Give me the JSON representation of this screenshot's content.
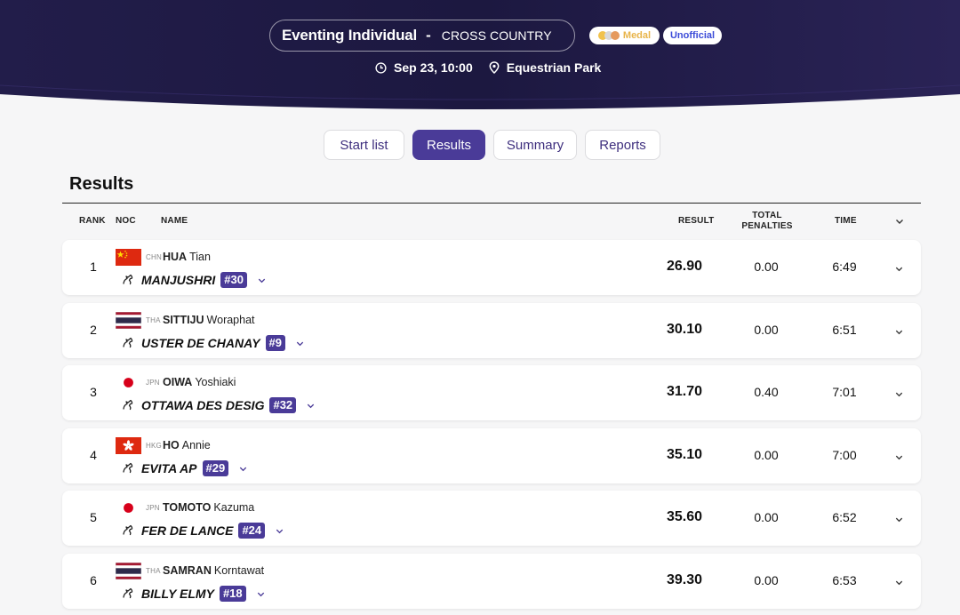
{
  "header": {
    "event_name": "Eventing Individual",
    "separator": "-",
    "phase": "CROSS COUNTRY",
    "badge_medal": "Medal",
    "badge_unofficial": "Unofficial",
    "datetime": "Sep 23, 10:00",
    "venue": "Equestrian Park",
    "colors": {
      "background": "#1e1a42",
      "medal_text": "#e8b44a",
      "unofficial_text": "#3b4bd8"
    }
  },
  "tabs": [
    {
      "label": "Start list",
      "active": false
    },
    {
      "label": "Results",
      "active": true
    },
    {
      "label": "Summary",
      "active": false
    },
    {
      "label": "Reports",
      "active": false
    }
  ],
  "section_title": "Results",
  "columns": {
    "rank": "RANK",
    "noc": "NOC",
    "name": "NAME",
    "result": "RESULT",
    "penalties_1": "TOTAL",
    "penalties_2": "PENALTIES",
    "time": "TIME"
  },
  "rows": [
    {
      "rank": "1",
      "noc": "CHN",
      "flag": "china-flag",
      "last": "HUA",
      "first": "Tian",
      "horse": "MANJUSHRI",
      "bib": "#30",
      "result": "26.90",
      "penalties": "0.00",
      "time": "6:49"
    },
    {
      "rank": "2",
      "noc": "THA",
      "flag": "thailand-flag",
      "last": "SITTIJU",
      "first": "Woraphat",
      "horse": "USTER DE CHANAY",
      "bib": "#9",
      "result": "30.10",
      "penalties": "0.00",
      "time": "6:51"
    },
    {
      "rank": "3",
      "noc": "JPN",
      "flag": "japan-flag",
      "last": "OIWA",
      "first": "Yoshiaki",
      "horse": "OTTAWA DES DESIG",
      "bib": "#32",
      "result": "31.70",
      "penalties": "0.40",
      "time": "7:01"
    },
    {
      "rank": "4",
      "noc": "HKG",
      "flag": "hong-kong-flag",
      "last": "HO",
      "first": "Annie",
      "horse": "EVITA AP",
      "bib": "#29",
      "result": "35.10",
      "penalties": "0.00",
      "time": "7:00"
    },
    {
      "rank": "5",
      "noc": "JPN",
      "flag": "japan-flag",
      "last": "TOMOTO",
      "first": "Kazuma",
      "horse": "FER DE LANCE",
      "bib": "#24",
      "result": "35.60",
      "penalties": "0.00",
      "time": "6:52"
    },
    {
      "rank": "6",
      "noc": "THA",
      "flag": "thailand-flag",
      "last": "SAMRAN",
      "first": "Korntawat",
      "horse": "BILLY ELMY",
      "bib": "#18",
      "result": "39.30",
      "penalties": "0.00",
      "time": "6:53"
    }
  ]
}
